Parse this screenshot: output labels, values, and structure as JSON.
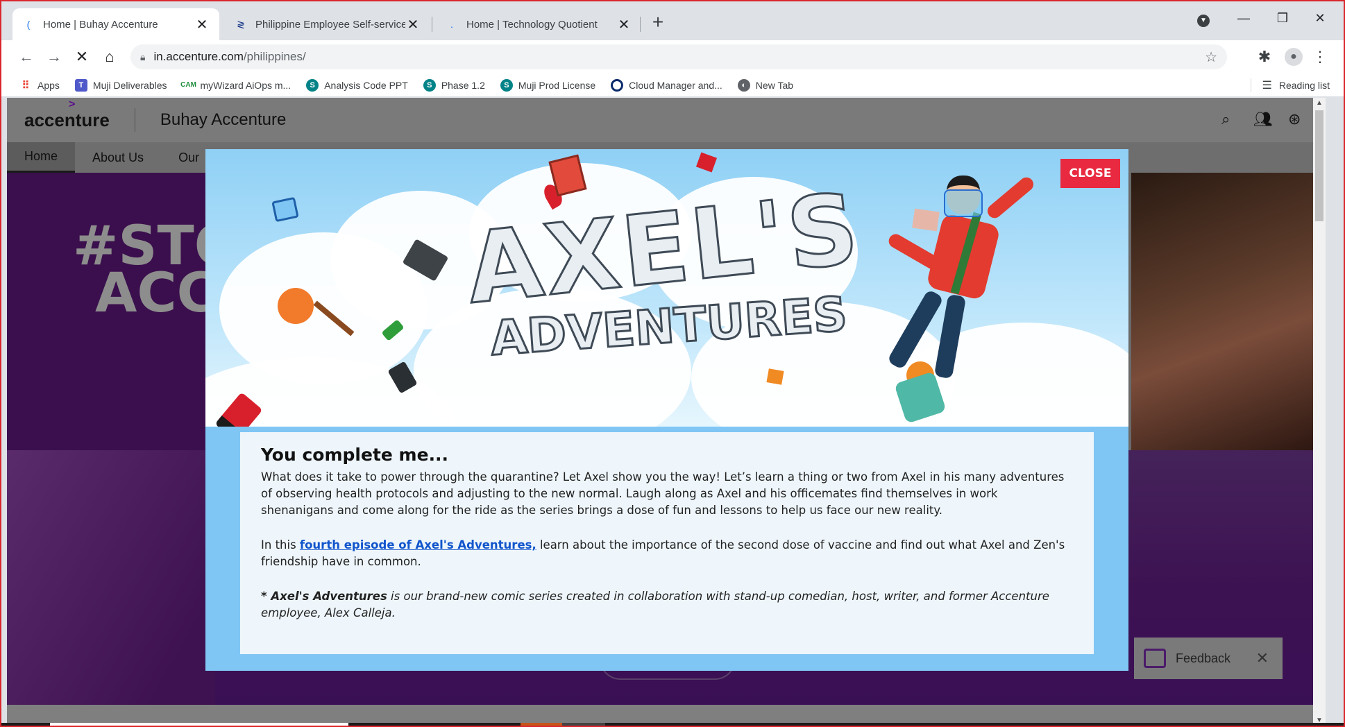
{
  "browser": {
    "tabs": [
      {
        "title": "Home | Buhay Accenture",
        "active": true
      },
      {
        "title": "Philippine Employee Self-service",
        "active": false
      },
      {
        "title": "Home | Technology Quotient",
        "active": false
      }
    ],
    "url_host": "in.accenture.com",
    "url_path": "/philippines/",
    "bookmarks": [
      {
        "label": "Apps",
        "icon": "apps-grid-icon"
      },
      {
        "label": "Muji Deliverables",
        "icon": "teams-icon"
      },
      {
        "label": "myWizard AiOps m...",
        "icon": "cam-icon"
      },
      {
        "label": "Analysis Code PPT",
        "icon": "sharepoint-icon"
      },
      {
        "label": "Phase 1.2",
        "icon": "sharepoint-icon"
      },
      {
        "label": "Muji Prod License",
        "icon": "sharepoint-icon"
      },
      {
        "label": "Cloud Manager and...",
        "icon": "circle-icon"
      },
      {
        "label": "New Tab",
        "icon": "globe-icon"
      }
    ],
    "reading_list": "Reading list"
  },
  "site": {
    "logo": "accenture",
    "name": "Buhay Accenture",
    "nav": [
      "Home",
      "About Us",
      "Our"
    ],
    "hero_text_line1": "#STO",
    "hero_text_line2": "ACC"
  },
  "modal": {
    "close_label": "CLOSE",
    "banner_line1": "AXEL'S",
    "banner_line2": "ADVENTURES",
    "heading": "You complete me...",
    "para1": "What does it take to power through the quarantine? Let Axel show you the way! Let’s learn a thing or two from Axel in his many adventures of observing health protocols and adjusting to the new normal. Laugh along as Axel and his officemates find themselves in work shenanigans and come along for the ride as the series brings a dose of fun and lessons to help us face our new reality.",
    "para2_prefix": "In this ",
    "para2_link": "fourth episode of Axel's Adventures,",
    "para2_suffix": " learn about the importance of the second dose of vaccine and find out what Axel and Zen's friendship have in common.",
    "note_bold": "* Axel's Adventures",
    "note_rest": " is our brand-new comic series created in collaboration with stand-up comedian, host, writer, and former Accenture employee, Alex Calleja."
  },
  "feedback": {
    "label": "Feedback"
  },
  "colors": {
    "close_red": "#e8293f",
    "modal_blue": "#7fc6f4",
    "link_blue": "#1155cc",
    "brand_purple": "#5b0a8f"
  }
}
